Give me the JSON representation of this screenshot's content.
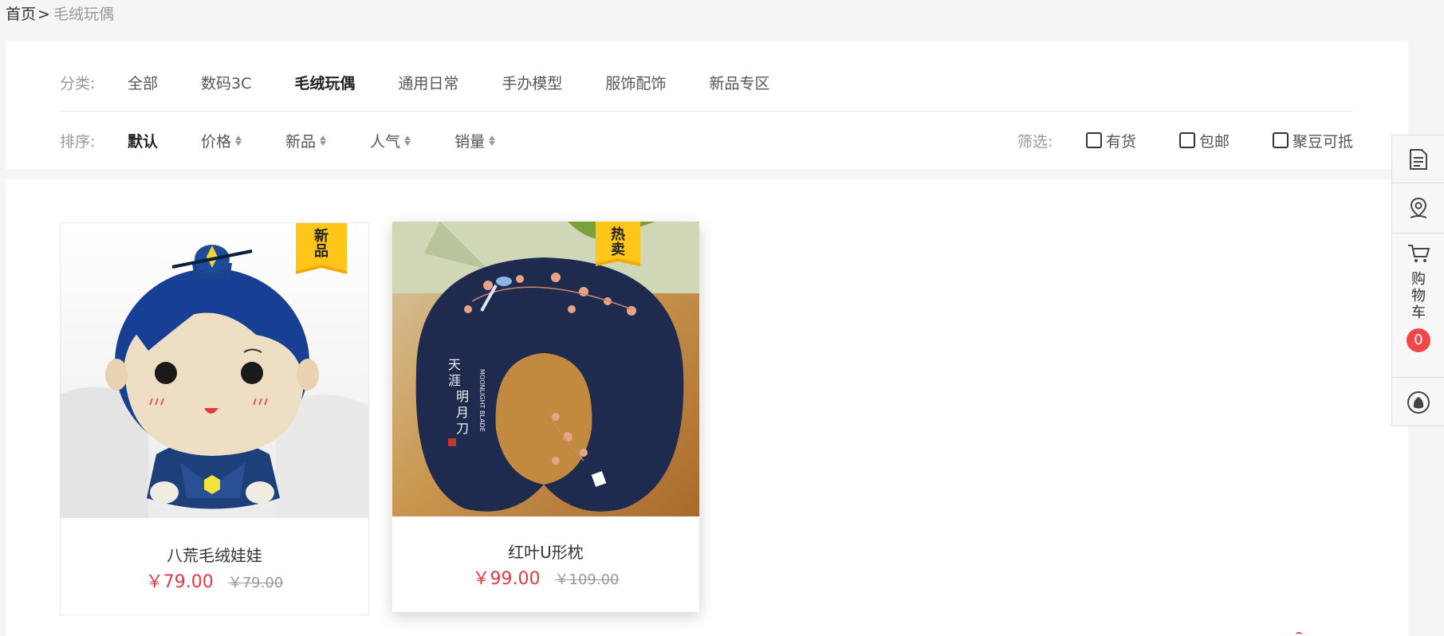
{
  "breadcrumb": {
    "home": "首页",
    "separator": ">",
    "current": "毛绒玩偶"
  },
  "category": {
    "label": "分类:",
    "items": [
      {
        "label": "全部",
        "active": false
      },
      {
        "label": "数码3C",
        "active": false
      },
      {
        "label": "毛绒玩偶",
        "active": true
      },
      {
        "label": "通用日常",
        "active": false
      },
      {
        "label": "手办模型",
        "active": false
      },
      {
        "label": "服饰配饰",
        "active": false
      },
      {
        "label": "新品专区",
        "active": false
      }
    ]
  },
  "sort": {
    "label": "排序:",
    "items": [
      {
        "label": "默认",
        "active": true
      },
      {
        "label": "价格"
      },
      {
        "label": "新品"
      },
      {
        "label": "人气"
      },
      {
        "label": "销量"
      }
    ]
  },
  "filter": {
    "label": "筛选:",
    "options": [
      {
        "label": "有货",
        "checked": false
      },
      {
        "label": "包邮",
        "checked": false
      },
      {
        "label": "聚豆可抵",
        "checked": false
      }
    ]
  },
  "products": [
    {
      "name": "八荒毛绒娃娃",
      "price": "￥79.00",
      "original_price": "￥79.00",
      "tag": "新品"
    },
    {
      "name": "红叶U形枕",
      "price": "￥99.00",
      "original_price": "￥109.00",
      "tag": "热卖"
    }
  ],
  "sidebar": {
    "cart_label": "购物车",
    "cart_count": "0",
    "icons": [
      "document-icon",
      "location-pin-icon",
      "cart-icon",
      "qq-icon"
    ]
  },
  "colors": {
    "price": "#e53946",
    "tag": "#ffc61a",
    "badge": "#f04848"
  }
}
